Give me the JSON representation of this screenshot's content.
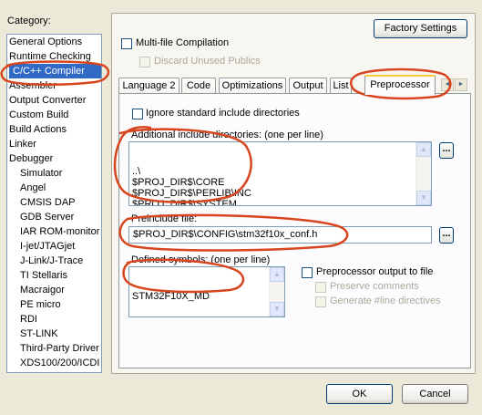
{
  "category": {
    "label": "Category:",
    "items": [
      {
        "label": "General Options",
        "level": 1
      },
      {
        "label": "Runtime Checking",
        "level": 1
      },
      {
        "label": "C/C++ Compiler",
        "level": 1,
        "selected": true
      },
      {
        "label": "Assembler",
        "level": 1
      },
      {
        "label": "Output Converter",
        "level": 1
      },
      {
        "label": "Custom Build",
        "level": 1
      },
      {
        "label": "Build Actions",
        "level": 1
      },
      {
        "label": "Linker",
        "level": 1
      },
      {
        "label": "Debugger",
        "level": 1
      },
      {
        "label": "Simulator",
        "level": 2
      },
      {
        "label": "Angel",
        "level": 2
      },
      {
        "label": "CMSIS DAP",
        "level": 2
      },
      {
        "label": "GDB Server",
        "level": 2
      },
      {
        "label": "IAR ROM-monitor",
        "level": 2
      },
      {
        "label": "I-jet/JTAGjet",
        "level": 2
      },
      {
        "label": "J-Link/J-Trace",
        "level": 2
      },
      {
        "label": "TI Stellaris",
        "level": 2
      },
      {
        "label": "Macraigor",
        "level": 2
      },
      {
        "label": "PE micro",
        "level": 2
      },
      {
        "label": "RDI",
        "level": 2
      },
      {
        "label": "ST-LINK",
        "level": 2
      },
      {
        "label": "Third-Party Driver",
        "level": 2
      },
      {
        "label": "XDS100/200/ICDI",
        "level": 2
      }
    ]
  },
  "factory_settings_label": "Factory Settings",
  "multi_file": {
    "label": "Multi-file Compilation",
    "checked": false
  },
  "discard_unused": {
    "label": "Discard Unused Publics",
    "checked": false,
    "enabled": false
  },
  "tabs": [
    {
      "label": "Language 2"
    },
    {
      "label": "Code"
    },
    {
      "label": "Optimizations"
    },
    {
      "label": "Output"
    },
    {
      "label": "List"
    },
    {
      "label": "Preprocessor",
      "active": true
    }
  ],
  "tab_scroll": {
    "left": "◄",
    "right": "►"
  },
  "ignore_std": {
    "label": "Ignore standard include directories",
    "checked": false
  },
  "include_dirs": {
    "label": "Additional include directories: (one per line)",
    "lines": [
      "..\\",
      "$PROJ_DIR$\\CORE",
      "$PROJ_DIR$\\PERLIB\\INC",
      "$PROJ_DIR$\\SYSTEM"
    ],
    "browse_label": "..."
  },
  "preinclude": {
    "label": "Preinclude file:",
    "value": "$PROJ_DIR$\\CONFIG\\stm32f10x_conf.h",
    "browse_label": "..."
  },
  "defined_symbols": {
    "label": "Defined symbols: (one per line)",
    "lines": [
      "STM32F10X_MD"
    ]
  },
  "pp_output": {
    "label": "Preprocessor output to file",
    "checked": false
  },
  "preserve_comments": {
    "label": "Preserve comments",
    "checked": false,
    "enabled": false
  },
  "generate_line": {
    "label": "Generate #line directives",
    "checked": false,
    "enabled": false
  },
  "ok_label": "OK",
  "cancel_label": "Cancel",
  "annotation_color": "#d7461e"
}
